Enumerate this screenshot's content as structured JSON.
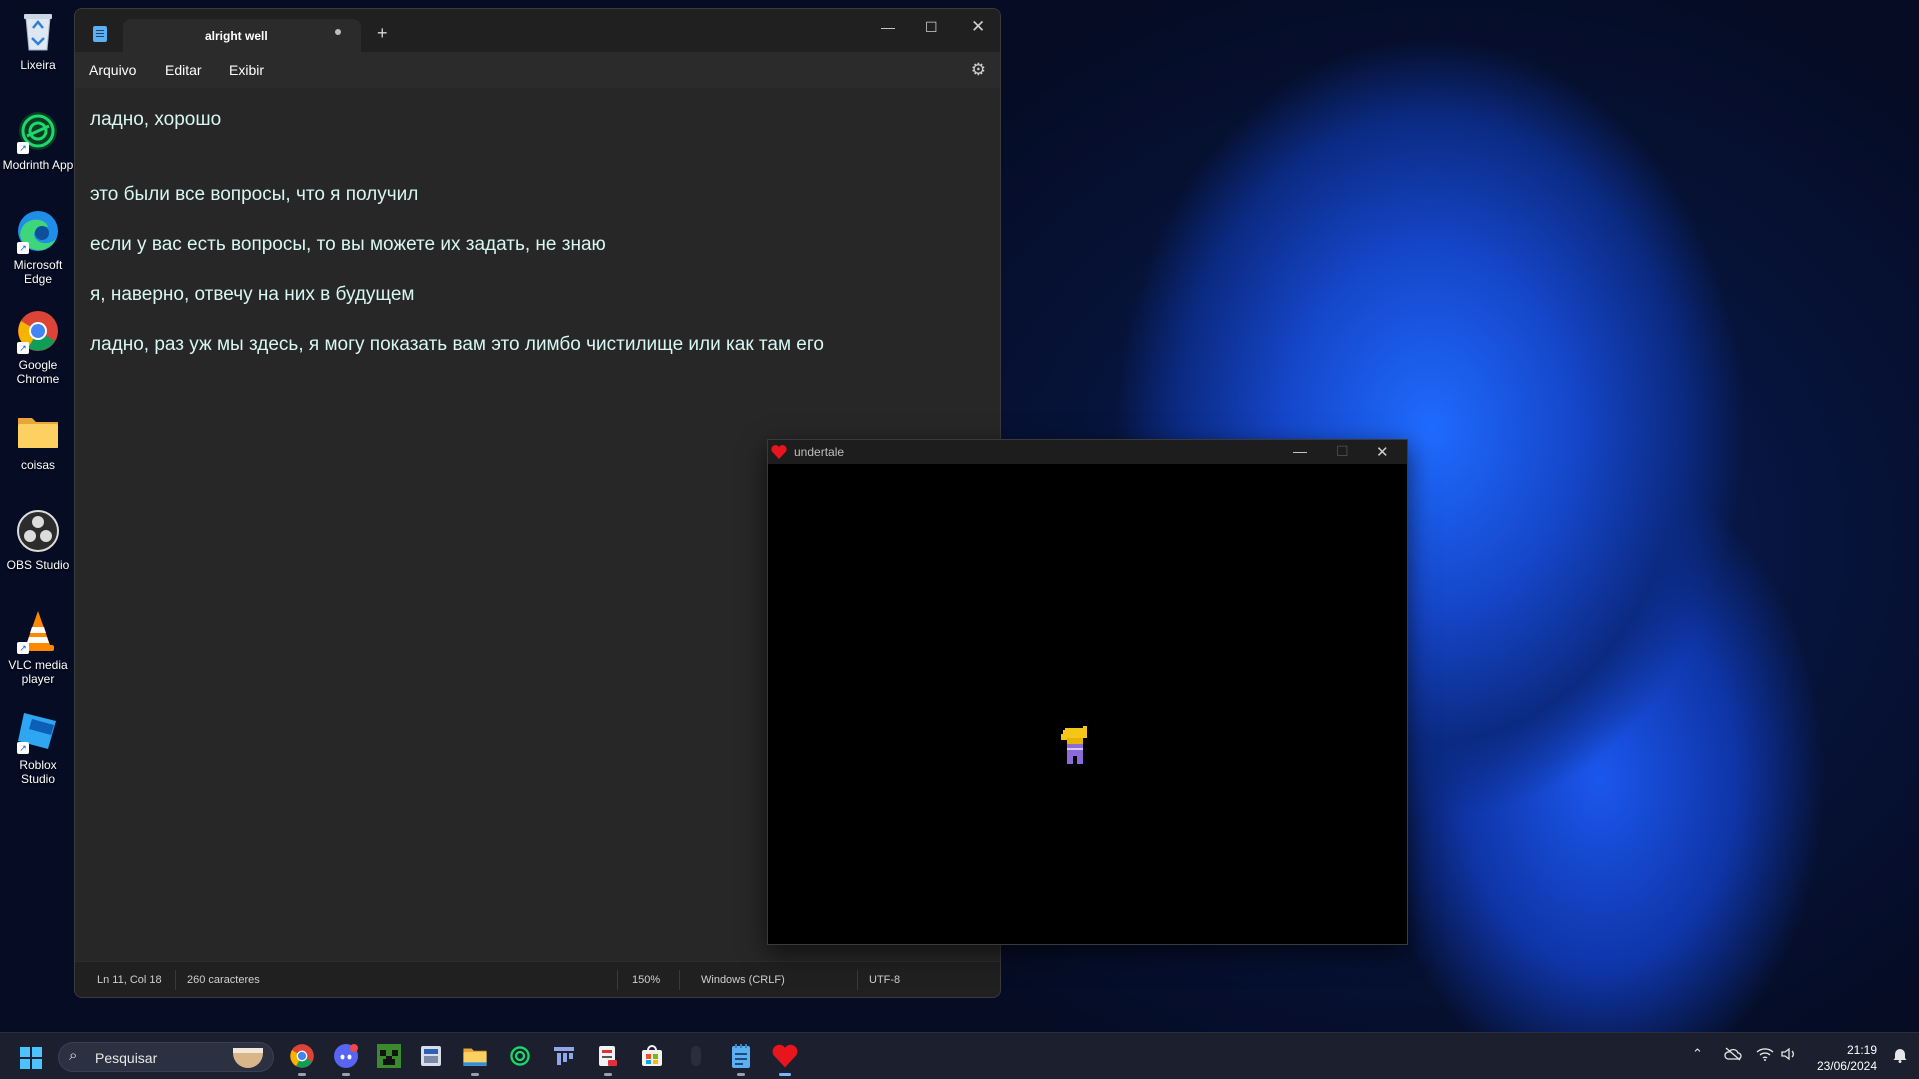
{
  "desktop": {
    "icons": [
      {
        "label": "Lixeira",
        "icon": "recycle-bin-icon"
      },
      {
        "label": "Modrinth App",
        "icon": "modrinth-icon"
      },
      {
        "label": "Microsoft Edge",
        "icon": "edge-icon"
      },
      {
        "label": "Google Chrome",
        "icon": "chrome-icon"
      },
      {
        "label": "coisas",
        "icon": "folder-icon"
      },
      {
        "label": "OBS Studio",
        "icon": "obs-icon"
      },
      {
        "label": "VLC media player",
        "icon": "vlc-icon"
      },
      {
        "label": "Roblox Studio",
        "icon": "roblox-studio-icon"
      }
    ]
  },
  "notepad": {
    "tab_title": "alright well",
    "new_tab": "+",
    "menu": {
      "file": "Arquivo",
      "edit": "Editar",
      "view": "Exibir"
    },
    "lines": [
      "ладно, хорошо",
      "",
      "это были все вопросы, что я получил",
      "если у вас есть вопросы, то вы можете их задать, не знаю",
      "я, наверно, отвечу на них в будущем",
      "ладно, раз уж мы здесь, я могу показать вам это лимбо чистилище или как там его"
    ],
    "status": {
      "position": "Ln 11, Col 18",
      "chars": "260 caracteres",
      "zoom": "150%",
      "line_ending": "Windows (CRLF)",
      "encoding": "UTF-8"
    },
    "text_color": "#d7f7f2"
  },
  "game_window": {
    "title": "undertale",
    "icon": "heart-icon",
    "accent": "#e8141e"
  },
  "taskbar": {
    "search_placeholder": "Pesquisar",
    "apps": [
      "chrome-icon",
      "discord-icon",
      "minecraft-icon",
      "app-icon",
      "file-explorer-icon",
      "modrinth-icon",
      "app-icon",
      "app-icon",
      "microsoft-store-icon",
      "app-icon",
      "notepad-icon",
      "undertale-icon"
    ],
    "time": "21:19",
    "date": "23/06/2024"
  }
}
